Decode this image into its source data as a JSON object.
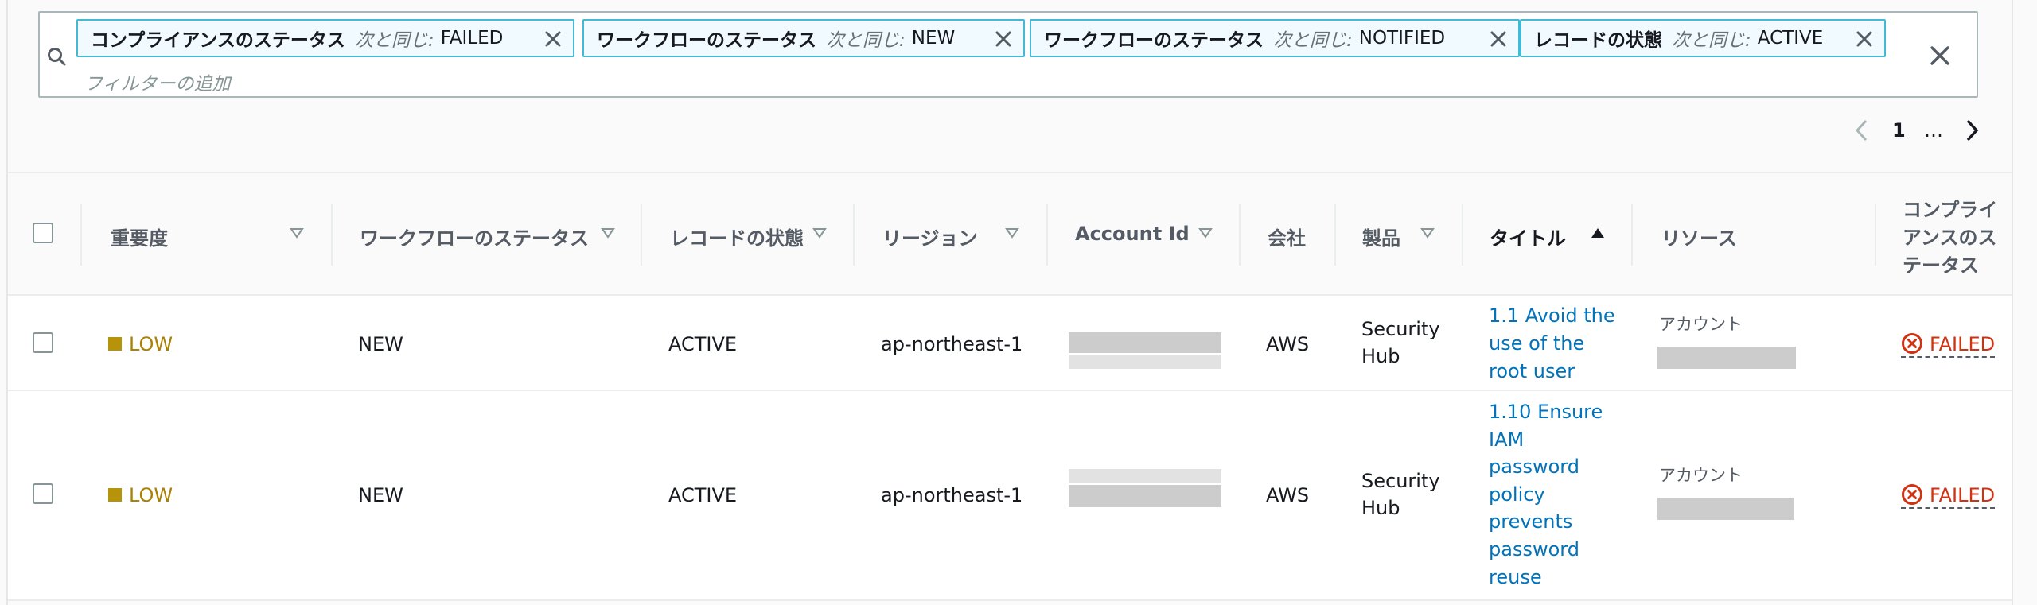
{
  "filters": {
    "tokens": [
      {
        "property": "コンプライアンスのステータス",
        "operator": "次と同じ:",
        "value": "FAILED"
      },
      {
        "property": "ワークフローのステータス",
        "operator": "次と同じ:",
        "value": "NEW"
      },
      {
        "property": "ワークフローのステータス",
        "operator": "次と同じ:",
        "value": "NOTIFIED"
      },
      {
        "property": "レコードの状態",
        "operator": "次と同じ:",
        "value": "ACTIVE"
      }
    ],
    "placeholder": "フィルターの追加"
  },
  "pagination": {
    "current_page": "1",
    "ellipsis": "…"
  },
  "table": {
    "columns": {
      "severity": "重要度",
      "workflow": "ワークフローのステータス",
      "record": "レコードの状態",
      "region": "リージョン",
      "account": "Account Id",
      "company": "会社",
      "product": "製品",
      "title": "タイトル",
      "resource": "リソース",
      "compliance_1": "コンプライ",
      "compliance_2": "アンスのス",
      "compliance_3": "テータス"
    },
    "rows": [
      {
        "severity": "LOW",
        "workflow": "NEW",
        "record": "ACTIVE",
        "region": "ap-northeast-1",
        "company": "AWS",
        "product_lines": [
          "Security",
          "Hub"
        ],
        "title_lines": [
          "1.1 Avoid the",
          "use of the",
          "root user"
        ],
        "resource_label": "アカウント",
        "compliance": "FAILED"
      },
      {
        "severity": "LOW",
        "workflow": "NEW",
        "record": "ACTIVE",
        "region": "ap-northeast-1",
        "company": "AWS",
        "product_lines": [
          "Security",
          "Hub"
        ],
        "title_lines": [
          "1.10 Ensure",
          "IAM",
          "password",
          "policy",
          "prevents",
          "password",
          "reuse"
        ],
        "resource_label": "アカウント",
        "compliance": "FAILED"
      }
    ]
  },
  "colors": {
    "token_border": "#44b9d6",
    "link": "#0073bb",
    "severity_low": "#b7930a",
    "failed": "#d13212"
  }
}
